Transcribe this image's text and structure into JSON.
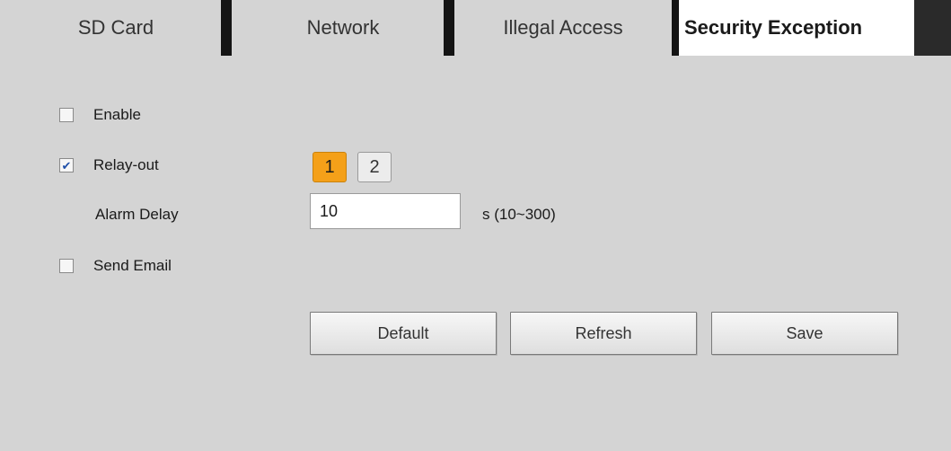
{
  "tabs": [
    {
      "label": "SD Card"
    },
    {
      "label": "Network"
    },
    {
      "label": "Illegal Access"
    },
    {
      "label": "Security Exception"
    }
  ],
  "active_tab": "Security Exception",
  "form": {
    "enable": {
      "label": "Enable",
      "checked": false
    },
    "relay_out": {
      "label": "Relay-out",
      "checked": true,
      "channels": [
        "1",
        "2"
      ],
      "selected": "1"
    },
    "alarm_delay": {
      "label": "Alarm Delay",
      "value": "10",
      "unit": "s (10~300)"
    },
    "send_email": {
      "label": "Send Email",
      "checked": false
    }
  },
  "buttons": {
    "default": "Default",
    "refresh": "Refresh",
    "save": "Save"
  },
  "colors": {
    "accent": "#f4a019",
    "background": "#d4d4d4",
    "tab_separator": "#141414"
  }
}
